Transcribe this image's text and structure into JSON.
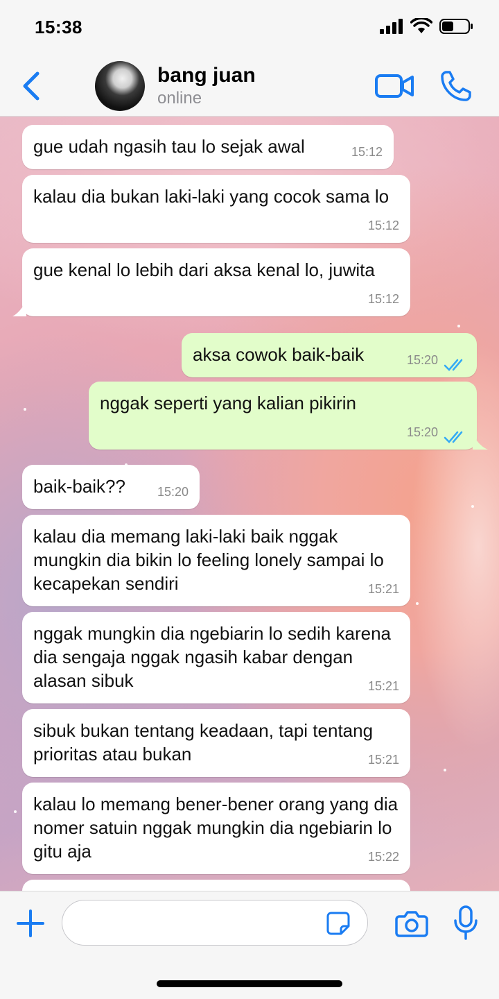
{
  "status_bar": {
    "time": "15:38"
  },
  "header": {
    "contact_name": "bang juan",
    "contact_status": "online",
    "icons": {
      "back": "chevron-left-icon",
      "video": "video-camera-icon",
      "call": "phone-icon"
    },
    "accent_color": "#1a7cf2"
  },
  "messages": [
    {
      "direction": "in",
      "text": "gue udah ngasih tau lo sejak awal",
      "time": "15:12"
    },
    {
      "direction": "in",
      "text": "kalau dia bukan laki-laki yang cocok sama lo",
      "time": "15:12"
    },
    {
      "direction": "in",
      "text": "gue kenal lo lebih dari aksa kenal lo, juwita",
      "time": "15:12"
    },
    {
      "direction": "out",
      "text": "aksa cowok baik-baik",
      "time": "15:20",
      "read": true
    },
    {
      "direction": "out",
      "text": "nggak seperti yang kalian pikirin",
      "time": "15:20",
      "read": true
    },
    {
      "direction": "in",
      "text": "baik-baik??",
      "time": "15:20"
    },
    {
      "direction": "in",
      "text": "kalau dia memang laki-laki baik nggak mungkin dia bikin lo feeling lonely sampai lo kecapekan sendiri",
      "time": "15:21"
    },
    {
      "direction": "in",
      "text": "nggak mungkin dia ngebiarin lo sedih karena dia sengaja nggak ngasih kabar dengan alasan sibuk",
      "time": "15:21"
    },
    {
      "direction": "in",
      "text": "sibuk bukan tentang keadaan, tapi tentang prioritas atau bukan",
      "time": "15:21"
    },
    {
      "direction": "in",
      "text": "kalau lo memang bener-bener orang yang dia nomer satuin nggak mungkin dia ngebiarin lo gitu aja",
      "time": "15:22"
    }
  ],
  "input_bar": {
    "placeholder": "",
    "icons": {
      "plus": "plus-icon",
      "sticker": "sticker-icon",
      "camera": "camera-icon",
      "mic": "microphone-icon"
    }
  },
  "colors": {
    "incoming_bubble": "#ffffff",
    "outgoing_bubble": "#e2fdca",
    "read_ticks": "#34aaf5"
  }
}
